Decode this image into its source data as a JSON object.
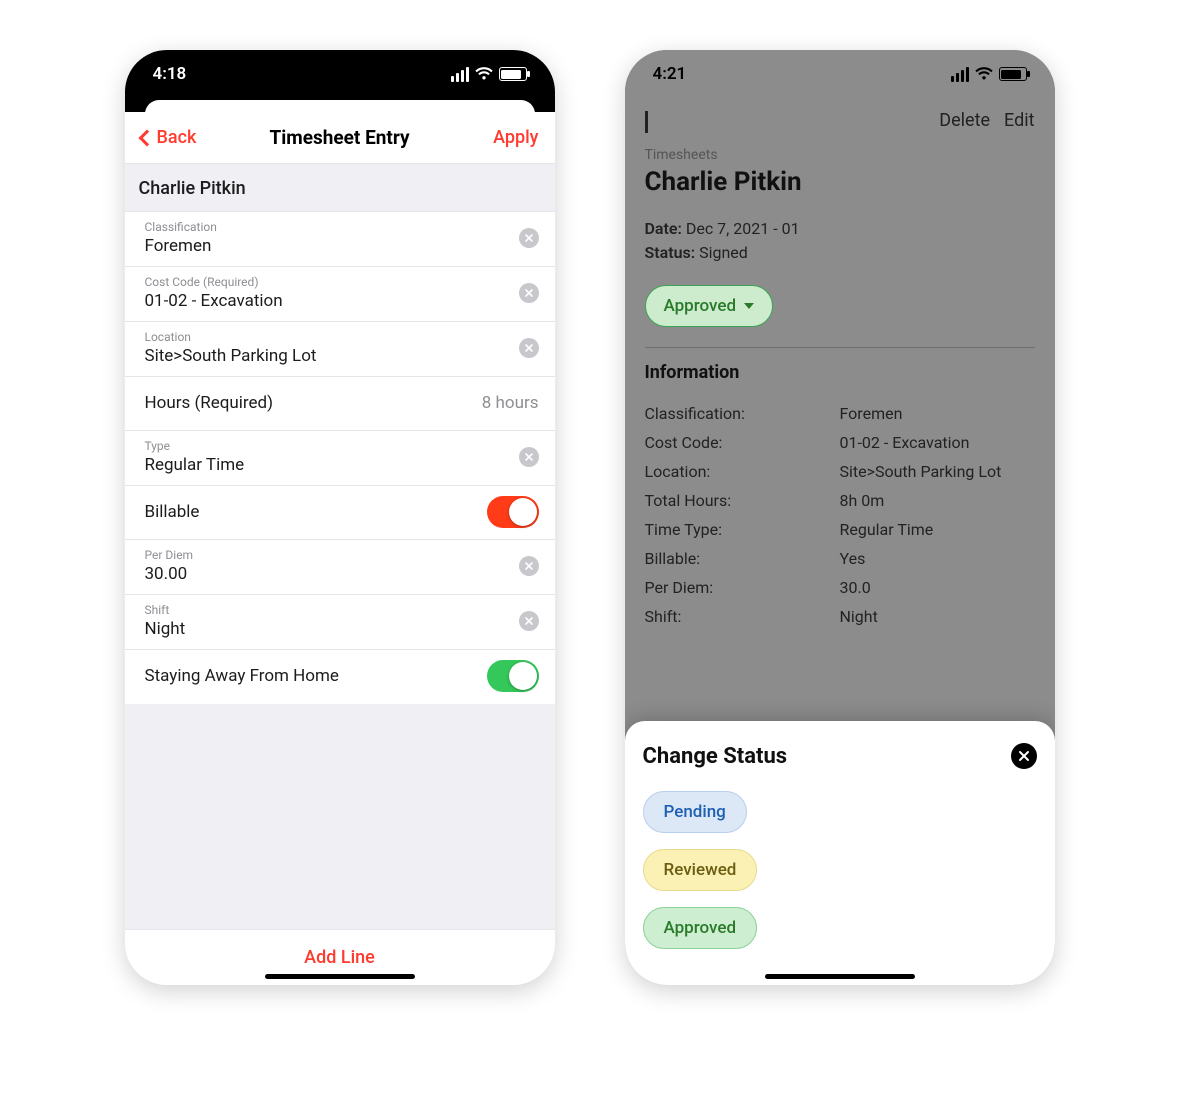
{
  "phoneA": {
    "status_time": "4:18",
    "nav": {
      "back": "Back",
      "title": "Timesheet Entry",
      "apply": "Apply"
    },
    "person": "Charlie Pitkin",
    "fields": {
      "classification_label": "Classification",
      "classification_value": "Foremen",
      "costcode_label": "Cost Code (Required)",
      "costcode_value": "01-02 - Excavation",
      "location_label": "Location",
      "location_value": "Site>South Parking Lot",
      "hours_label": "Hours (Required)",
      "hours_value": "8 hours",
      "type_label": "Type",
      "type_value": "Regular Time",
      "billable_label": "Billable",
      "billable_on": true,
      "perdiem_label": "Per Diem",
      "perdiem_value": "30.00",
      "shift_label": "Shift",
      "shift_value": "Night",
      "away_label": "Staying Away From Home",
      "away_on": true
    },
    "footer": "Add Line"
  },
  "phoneB": {
    "status_time": "4:21",
    "actions": {
      "delete": "Delete",
      "edit": "Edit"
    },
    "crumb": "Timesheets",
    "person": "Charlie Pitkin",
    "date_label": "Date:",
    "date_value": "Dec 7, 2021 - 01",
    "status_label": "Status:",
    "status_value": "Signed",
    "approved_pill": "Approved",
    "section_title": "Information",
    "info": [
      {
        "k": "Classification:",
        "v": "Foremen"
      },
      {
        "k": "Cost Code:",
        "v": "01-02 - Excavation"
      },
      {
        "k": "Location:",
        "v": "Site>South Parking Lot"
      },
      {
        "k": "Total Hours:",
        "v": "8h 0m"
      },
      {
        "k": "Time Type:",
        "v": "Regular Time"
      },
      {
        "k": "Billable:",
        "v": "Yes"
      },
      {
        "k": "Per Diem:",
        "v": "30.0"
      },
      {
        "k": "Shift:",
        "v": "Night"
      }
    ],
    "sheet": {
      "title": "Change Status",
      "pending": "Pending",
      "reviewed": "Reviewed",
      "approved": "Approved"
    }
  }
}
